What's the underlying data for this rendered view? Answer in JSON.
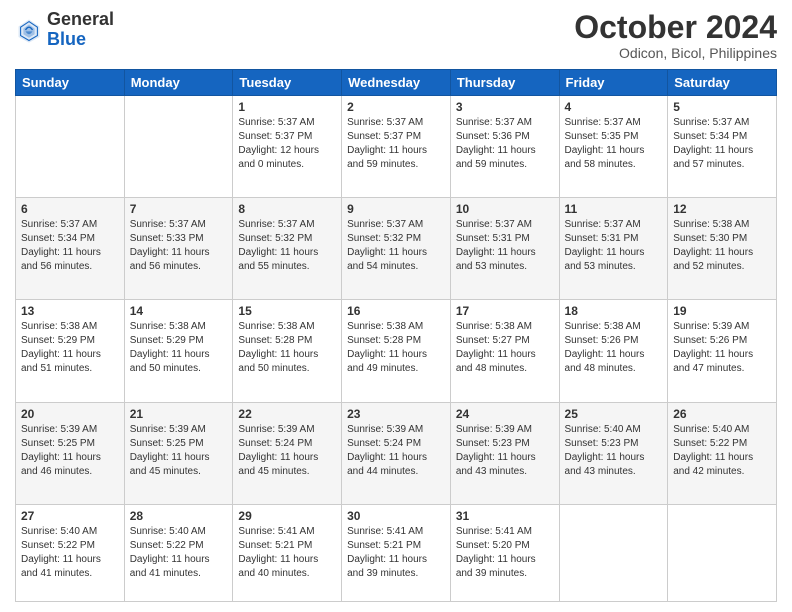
{
  "header": {
    "logo": {
      "general": "General",
      "blue": "Blue"
    },
    "title": "October 2024",
    "subtitle": "Odicon, Bicol, Philippines"
  },
  "days_of_week": [
    "Sunday",
    "Monday",
    "Tuesday",
    "Wednesday",
    "Thursday",
    "Friday",
    "Saturday"
  ],
  "weeks": [
    [
      {
        "day": "",
        "info": ""
      },
      {
        "day": "",
        "info": ""
      },
      {
        "day": "1",
        "info": "Sunrise: 5:37 AM\nSunset: 5:37 PM\nDaylight: 12 hours\nand 0 minutes."
      },
      {
        "day": "2",
        "info": "Sunrise: 5:37 AM\nSunset: 5:37 PM\nDaylight: 11 hours\nand 59 minutes."
      },
      {
        "day": "3",
        "info": "Sunrise: 5:37 AM\nSunset: 5:36 PM\nDaylight: 11 hours\nand 59 minutes."
      },
      {
        "day": "4",
        "info": "Sunrise: 5:37 AM\nSunset: 5:35 PM\nDaylight: 11 hours\nand 58 minutes."
      },
      {
        "day": "5",
        "info": "Sunrise: 5:37 AM\nSunset: 5:34 PM\nDaylight: 11 hours\nand 57 minutes."
      }
    ],
    [
      {
        "day": "6",
        "info": "Sunrise: 5:37 AM\nSunset: 5:34 PM\nDaylight: 11 hours\nand 56 minutes."
      },
      {
        "day": "7",
        "info": "Sunrise: 5:37 AM\nSunset: 5:33 PM\nDaylight: 11 hours\nand 56 minutes."
      },
      {
        "day": "8",
        "info": "Sunrise: 5:37 AM\nSunset: 5:32 PM\nDaylight: 11 hours\nand 55 minutes."
      },
      {
        "day": "9",
        "info": "Sunrise: 5:37 AM\nSunset: 5:32 PM\nDaylight: 11 hours\nand 54 minutes."
      },
      {
        "day": "10",
        "info": "Sunrise: 5:37 AM\nSunset: 5:31 PM\nDaylight: 11 hours\nand 53 minutes."
      },
      {
        "day": "11",
        "info": "Sunrise: 5:37 AM\nSunset: 5:31 PM\nDaylight: 11 hours\nand 53 minutes."
      },
      {
        "day": "12",
        "info": "Sunrise: 5:38 AM\nSunset: 5:30 PM\nDaylight: 11 hours\nand 52 minutes."
      }
    ],
    [
      {
        "day": "13",
        "info": "Sunrise: 5:38 AM\nSunset: 5:29 PM\nDaylight: 11 hours\nand 51 minutes."
      },
      {
        "day": "14",
        "info": "Sunrise: 5:38 AM\nSunset: 5:29 PM\nDaylight: 11 hours\nand 50 minutes."
      },
      {
        "day": "15",
        "info": "Sunrise: 5:38 AM\nSunset: 5:28 PM\nDaylight: 11 hours\nand 50 minutes."
      },
      {
        "day": "16",
        "info": "Sunrise: 5:38 AM\nSunset: 5:28 PM\nDaylight: 11 hours\nand 49 minutes."
      },
      {
        "day": "17",
        "info": "Sunrise: 5:38 AM\nSunset: 5:27 PM\nDaylight: 11 hours\nand 48 minutes."
      },
      {
        "day": "18",
        "info": "Sunrise: 5:38 AM\nSunset: 5:26 PM\nDaylight: 11 hours\nand 48 minutes."
      },
      {
        "day": "19",
        "info": "Sunrise: 5:39 AM\nSunset: 5:26 PM\nDaylight: 11 hours\nand 47 minutes."
      }
    ],
    [
      {
        "day": "20",
        "info": "Sunrise: 5:39 AM\nSunset: 5:25 PM\nDaylight: 11 hours\nand 46 minutes."
      },
      {
        "day": "21",
        "info": "Sunrise: 5:39 AM\nSunset: 5:25 PM\nDaylight: 11 hours\nand 45 minutes."
      },
      {
        "day": "22",
        "info": "Sunrise: 5:39 AM\nSunset: 5:24 PM\nDaylight: 11 hours\nand 45 minutes."
      },
      {
        "day": "23",
        "info": "Sunrise: 5:39 AM\nSunset: 5:24 PM\nDaylight: 11 hours\nand 44 minutes."
      },
      {
        "day": "24",
        "info": "Sunrise: 5:39 AM\nSunset: 5:23 PM\nDaylight: 11 hours\nand 43 minutes."
      },
      {
        "day": "25",
        "info": "Sunrise: 5:40 AM\nSunset: 5:23 PM\nDaylight: 11 hours\nand 43 minutes."
      },
      {
        "day": "26",
        "info": "Sunrise: 5:40 AM\nSunset: 5:22 PM\nDaylight: 11 hours\nand 42 minutes."
      }
    ],
    [
      {
        "day": "27",
        "info": "Sunrise: 5:40 AM\nSunset: 5:22 PM\nDaylight: 11 hours\nand 41 minutes."
      },
      {
        "day": "28",
        "info": "Sunrise: 5:40 AM\nSunset: 5:22 PM\nDaylight: 11 hours\nand 41 minutes."
      },
      {
        "day": "29",
        "info": "Sunrise: 5:41 AM\nSunset: 5:21 PM\nDaylight: 11 hours\nand 40 minutes."
      },
      {
        "day": "30",
        "info": "Sunrise: 5:41 AM\nSunset: 5:21 PM\nDaylight: 11 hours\nand 39 minutes."
      },
      {
        "day": "31",
        "info": "Sunrise: 5:41 AM\nSunset: 5:20 PM\nDaylight: 11 hours\nand 39 minutes."
      },
      {
        "day": "",
        "info": ""
      },
      {
        "day": "",
        "info": ""
      }
    ]
  ]
}
